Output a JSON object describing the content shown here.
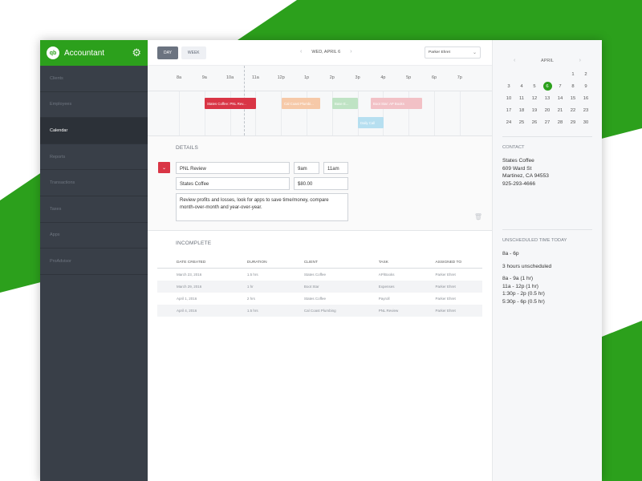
{
  "brand": {
    "name": "Accountant",
    "logo": "qb",
    "color": "#2ca01c"
  },
  "nav": [
    {
      "label": "Clients",
      "active": false
    },
    {
      "label": "Employees",
      "active": false
    },
    {
      "label": "Calendar",
      "active": true
    },
    {
      "label": "Reports",
      "active": false
    },
    {
      "label": "Transactions",
      "active": false
    },
    {
      "label": "Taxes",
      "active": false
    },
    {
      "label": "Apps",
      "active": false
    },
    {
      "label": "ProAdvisor",
      "active": false
    }
  ],
  "topbar": {
    "tab_day": "DAY",
    "tab_week": "WEEK",
    "date": "WED, APRIL 6",
    "assignee": "Parker Ehret"
  },
  "hours": [
    "8a",
    "9a",
    "10a",
    "11a",
    "12p",
    "1p",
    "2p",
    "3p",
    "4p",
    "5p",
    "6p",
    "7p"
  ],
  "events": [
    {
      "label": "States Coffee: PNL Rev...",
      "color": "#d93545"
    },
    {
      "label": "Cal Coast Plumbi...",
      "color": "#f6c9a8"
    },
    {
      "label": "Base E...",
      "color": "#bfe3c4"
    },
    {
      "label": "Boot Star: AP Books",
      "color": "#f2c1c6"
    },
    {
      "label": "Daily Call",
      "color": "#b6dff0"
    }
  ],
  "details": {
    "title": "DETAILS",
    "task": "PNL Review",
    "start": "9am",
    "end": "11am",
    "client": "States Coffee",
    "amount": "$80.00",
    "notes": "Review profits and losses, look for apps to save time/money, compare month-over-month and year-over-year."
  },
  "incomplete": {
    "title": "INCOMPLETE",
    "columns": [
      "DATE CREATED",
      "DURATION",
      "CLIENT",
      "TASK",
      "ASSIGNED TO"
    ],
    "rows": [
      [
        "March 23, 2016",
        "1.5 hrs",
        "States Coffee",
        "AP/Books",
        "Parker Ehret"
      ],
      [
        "March 29, 2016",
        "1 hr",
        "Boot Star",
        "Expenses",
        "Parker Ehret"
      ],
      [
        "April 1, 2016",
        "2 hrs",
        "States Coffee",
        "Payroll",
        "Parker Ehret"
      ],
      [
        "April 4, 2016",
        "1.5 hrs",
        "Cal Coast Plumbing",
        "PNL Review",
        "Parker Ehret"
      ]
    ]
  },
  "calendar": {
    "month": "APRIL",
    "days": [
      "",
      "",
      "",
      "",
      "",
      "1",
      "2",
      "3",
      "4",
      "5",
      "6",
      "7",
      "8",
      "9",
      "10",
      "11",
      "12",
      "13",
      "14",
      "15",
      "16",
      "17",
      "18",
      "19",
      "20",
      "21",
      "22",
      "23",
      "24",
      "25",
      "26",
      "27",
      "28",
      "29",
      "30"
    ],
    "selected": "6"
  },
  "contact": {
    "title": "CONTACT",
    "name": "States Coffee",
    "street": "609 Ward St",
    "city": "Martinez, CA 94553",
    "phone": "925-293-4666"
  },
  "unscheduled": {
    "title": "UNSCHEDULED TIME TODAY",
    "range": "8a - 6p",
    "summary": "3 hours unscheduled",
    "slots": [
      "8a - 9a  (1 hr)",
      "11a - 12p  (1 hr)",
      "1:30p - 2p  (0.5 hr)",
      "5:30p - 6p  (0.5 hr)"
    ]
  }
}
